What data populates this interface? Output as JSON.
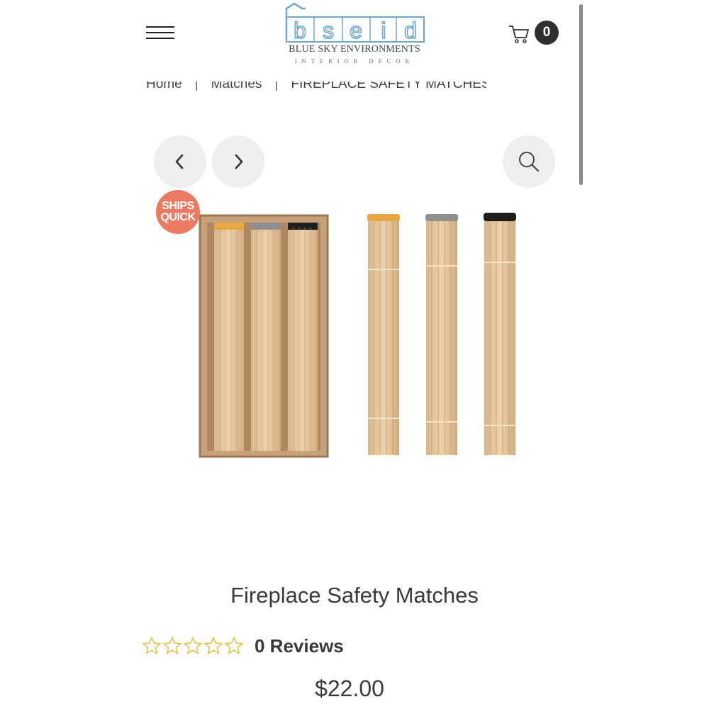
{
  "header": {
    "logo_letters": [
      "b",
      "s",
      "e",
      "i",
      "d"
    ],
    "logo_tagline": "BLUE SKY ENVIRONMENTS",
    "logo_subtagline": "INTERIOR DECOR",
    "cart_count": "0",
    "icons": {
      "menu": "hamburger-menu-icon",
      "cart": "shopping-cart-icon"
    }
  },
  "breadcrumb": {
    "items": [
      "Home",
      "Matches",
      "FIREPLACE SAFETY MATCHES"
    ],
    "separator": "|"
  },
  "gallery": {
    "icons": {
      "prev": "chevron-left-icon",
      "next": "chevron-right-icon",
      "zoom": "magnifier-icon"
    },
    "badge": {
      "line1": "SHIPS",
      "line2": "QUICK"
    },
    "match_head_colors": [
      "#e8a645",
      "#8f8f92",
      "#1d1d1d"
    ]
  },
  "product": {
    "title": "Fireplace Safety Matches",
    "rating": 0,
    "rating_max": 5,
    "reviews_label": "0 Reviews",
    "price": "$22.00"
  },
  "colors": {
    "logo_blue": "#6fa7c9",
    "badge": "#ec7a62",
    "star_outline": "#e8bf3c",
    "button_bg": "#efeeec"
  }
}
